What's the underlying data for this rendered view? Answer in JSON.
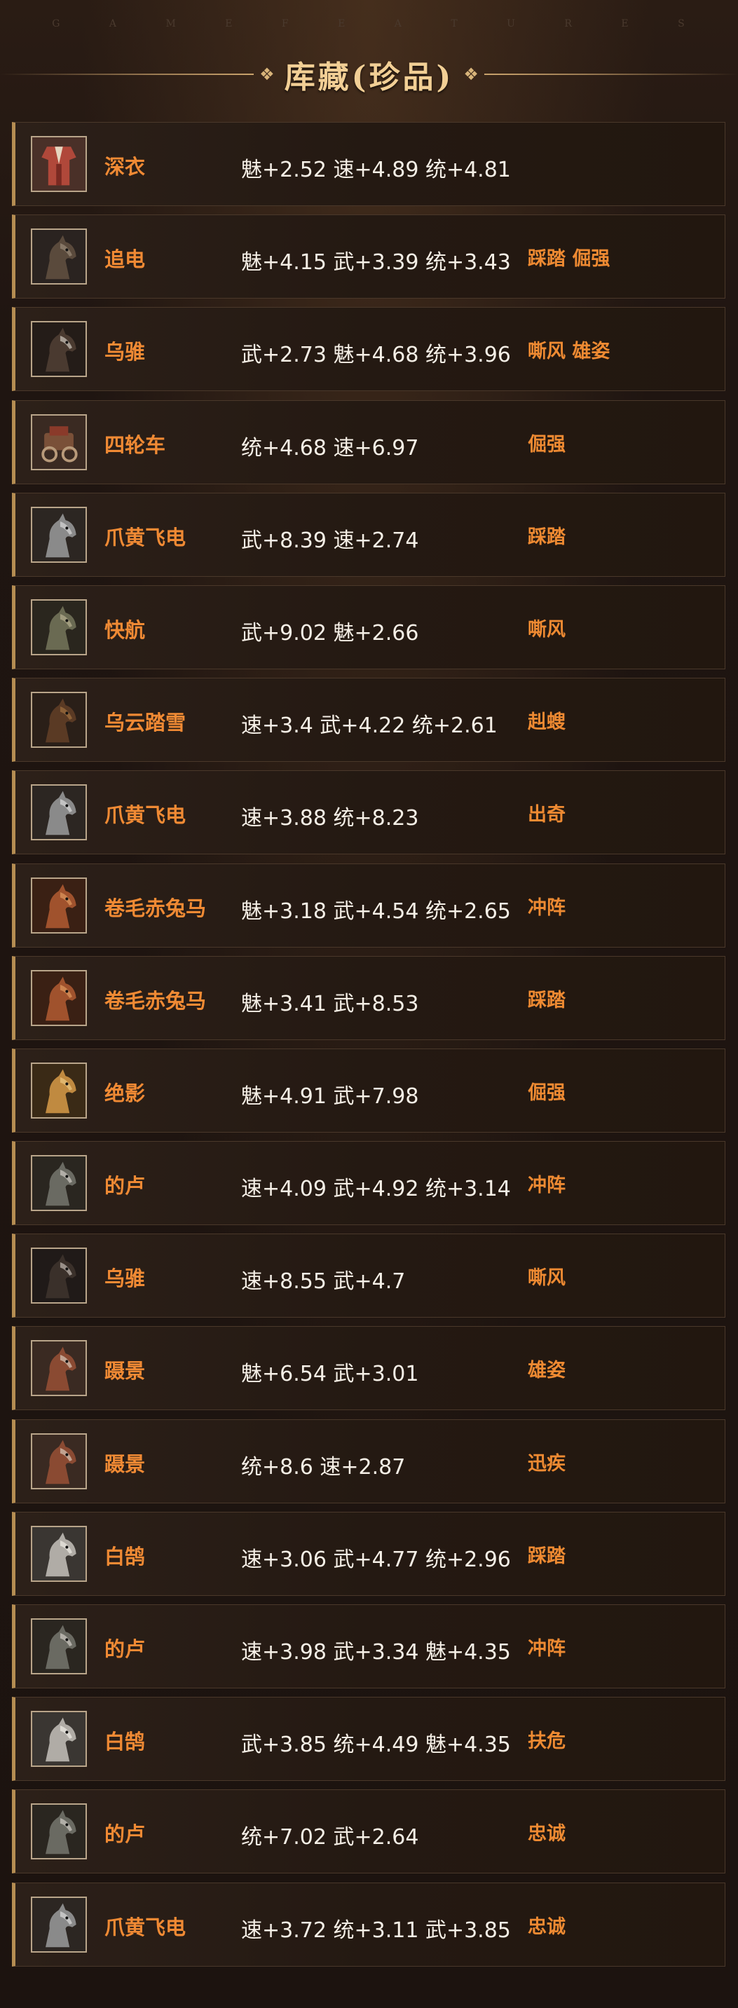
{
  "header": {
    "deco_letters": [
      "G",
      "A",
      "M",
      "E",
      "F",
      "E",
      "A",
      "T",
      "U",
      "R",
      "E",
      "S"
    ],
    "title": "库藏(珍品)",
    "ornament_left": "❖",
    "ornament_right": "❖"
  },
  "colors": {
    "accent_orange": "#f08a34",
    "title_gold": "#f2cf95",
    "row_border_gold": "#b58d52",
    "text_white": "#f5efe6"
  },
  "items": [
    {
      "name": "深衣",
      "stats": "魅+2.52 速+4.89 统+4.81",
      "skills": "",
      "icon": "robe-icon"
    },
    {
      "name": "追电",
      "stats": "魅+4.15 武+3.39 统+3.43",
      "skills": "踩踏 倔强",
      "icon": "horse-icon"
    },
    {
      "name": "乌骓",
      "stats": "武+2.73 魅+4.68 统+3.96",
      "skills": "嘶风 雄姿",
      "icon": "horse-icon"
    },
    {
      "name": "四轮车",
      "stats": "统+4.68 速+6.97",
      "skills": "倔强",
      "icon": "cart-icon"
    },
    {
      "name": "爪黄飞电",
      "stats": "武+8.39 速+2.74",
      "skills": "踩踏",
      "icon": "horse-icon"
    },
    {
      "name": "快航",
      "stats": "武+9.02 魅+2.66",
      "skills": "嘶风",
      "icon": "horse-icon"
    },
    {
      "name": "乌云踏雪",
      "stats": "速+3.4 武+4.22 统+2.61",
      "skills": "赳螋",
      "icon": "horse-icon"
    },
    {
      "name": "爪黄飞电",
      "stats": "速+3.88 统+8.23",
      "skills": "出奇",
      "icon": "horse-icon"
    },
    {
      "name": "卷毛赤兔马",
      "stats": "魅+3.18 武+4.54 统+2.65",
      "skills": "冲阵",
      "icon": "horse-icon"
    },
    {
      "name": "卷毛赤兔马",
      "stats": "魅+3.41 武+8.53",
      "skills": "踩踏",
      "icon": "horse-icon"
    },
    {
      "name": "绝影",
      "stats": "魅+4.91 武+7.98",
      "skills": "倔强",
      "icon": "horse-icon"
    },
    {
      "name": "的卢",
      "stats": "速+4.09 武+4.92 统+3.14",
      "skills": "冲阵",
      "icon": "horse-icon"
    },
    {
      "name": "乌骓",
      "stats": "速+8.55 武+4.7",
      "skills": "嘶风",
      "icon": "horse-icon"
    },
    {
      "name": "蹑景",
      "stats": "魅+6.54 武+3.01",
      "skills": "雄姿",
      "icon": "horse-icon"
    },
    {
      "name": "蹑景",
      "stats": "统+8.6 速+2.87",
      "skills": "迅疾",
      "icon": "horse-icon"
    },
    {
      "name": "白鹄",
      "stats": "速+3.06 武+4.77 统+2.96",
      "skills": "踩踏",
      "icon": "horse-icon"
    },
    {
      "name": "的卢",
      "stats": "速+3.98 武+3.34 魅+4.35",
      "skills": "冲阵",
      "icon": "horse-icon"
    },
    {
      "name": "白鹄",
      "stats": "武+3.85 统+4.49 魅+4.35",
      "skills": "扶危",
      "icon": "horse-icon"
    },
    {
      "name": "的卢",
      "stats": "统+7.02 武+2.64",
      "skills": "忠诚",
      "icon": "horse-icon"
    },
    {
      "name": "爪黄飞电",
      "stats": "速+3.72 统+3.11 武+3.85",
      "skills": "忠诚",
      "icon": "horse-icon"
    }
  ]
}
